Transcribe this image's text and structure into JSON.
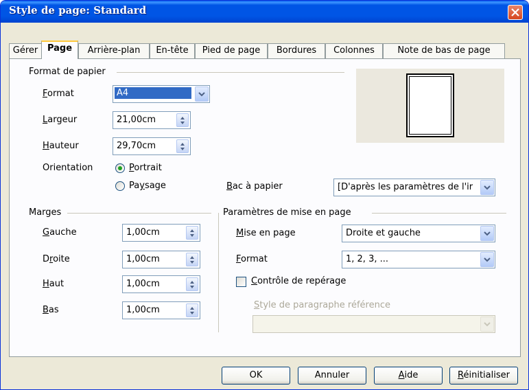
{
  "window": {
    "title": "Style de page: Standard"
  },
  "tabs": [
    {
      "label": "Gérer",
      "active": false
    },
    {
      "label": "Page",
      "active": true
    },
    {
      "label": "Arrière-plan",
      "active": false
    },
    {
      "label": "En-tête",
      "active": false
    },
    {
      "label": "Pied de page",
      "active": false
    },
    {
      "label": "Bordures",
      "active": false
    },
    {
      "label": "Colonnes",
      "active": false
    },
    {
      "label": "Note de bas de page",
      "active": false
    }
  ],
  "paper_format": {
    "group_label": "Format de papier",
    "format_label": "Format",
    "format_value": "A4",
    "width_label": "Largeur",
    "width_value": "21,00cm",
    "height_label": "Hauteur",
    "height_value": "29,70cm",
    "orientation_label": "Orientation",
    "portrait_label": "Portrait",
    "landscape_label": "Paysage",
    "orientation_selected": "Portrait",
    "tray_label": "Bac à papier",
    "tray_value": "[D'après les paramètres de l'ir"
  },
  "margins": {
    "group_label": "Marges",
    "left_label": "Gauche",
    "left_value": "1,00cm",
    "right_label": "Droite",
    "right_value": "1,00cm",
    "top_label": "Haut",
    "top_value": "1,00cm",
    "bottom_label": "Bas",
    "bottom_value": "1,00cm"
  },
  "layout": {
    "group_label": "Paramètres de mise en page",
    "layout_label": "Mise en page",
    "layout_value": "Droite et gauche",
    "format_label": "Format",
    "format_value": "1, 2, 3, ...",
    "register_label": "Contrôle de repérage",
    "register_checked": false,
    "ref_style_label": "Style de paragraphe référence",
    "ref_style_value": ""
  },
  "buttons": {
    "ok": "OK",
    "cancel": "Annuler",
    "help": "Aide",
    "reset": "Réinitialiser"
  },
  "colors": {
    "titlebar": "#0055E5",
    "dialog_bg": "#ECE9D8",
    "tab_active_accent": "#FFC83C",
    "selection": "#316AC5"
  }
}
